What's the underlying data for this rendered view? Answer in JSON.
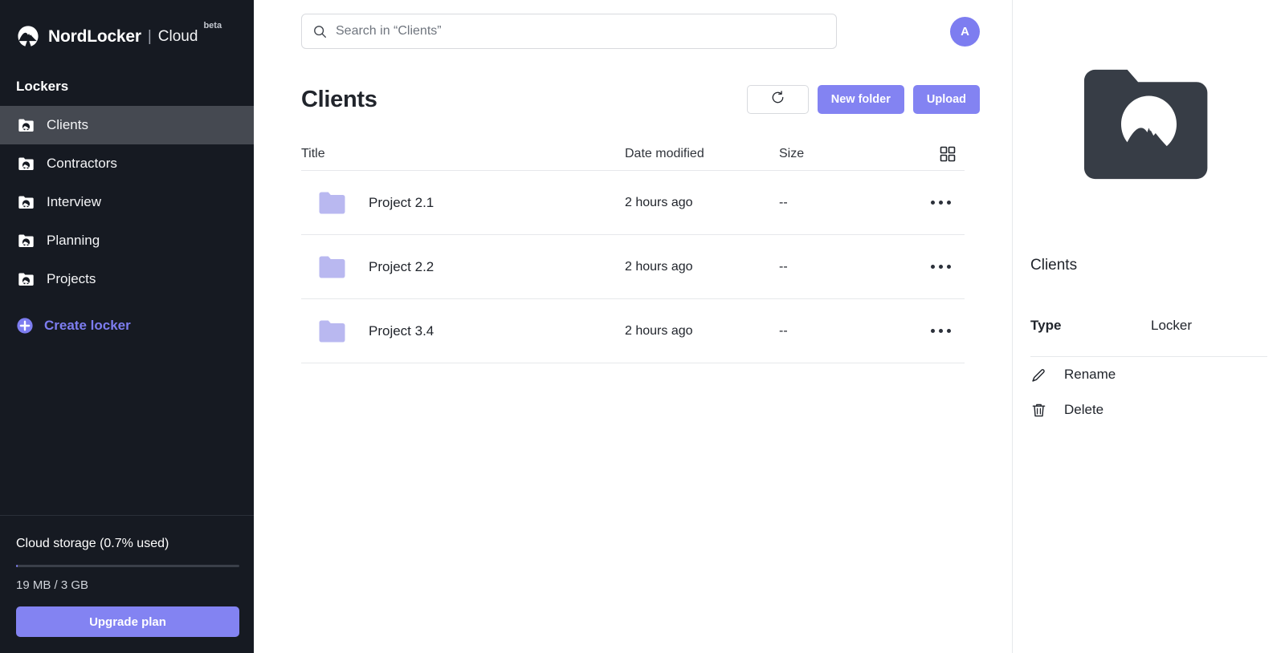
{
  "brand": {
    "name": "NordLocker",
    "separator": "|",
    "product": "Cloud",
    "badge": "beta",
    "logo_icon": "nordlocker-mountain-icon"
  },
  "sidebar": {
    "section_title": "Lockers",
    "items": [
      {
        "label": "Clients",
        "icon": "locker-folder-icon",
        "active": true
      },
      {
        "label": "Contractors",
        "icon": "locker-folder-icon",
        "active": false
      },
      {
        "label": "Interview",
        "icon": "locker-folder-icon",
        "active": false
      },
      {
        "label": "Planning",
        "icon": "locker-folder-icon",
        "active": false
      },
      {
        "label": "Projects",
        "icon": "locker-folder-icon",
        "active": false
      }
    ],
    "create_locker": {
      "label": "Create locker",
      "icon": "plus-circle-icon"
    },
    "storage": {
      "title": "Cloud storage (0.7% used)",
      "percent_used": 0.7,
      "detail": "19 MB / 3 GB",
      "upgrade_label": "Upgrade plan"
    },
    "colors": {
      "background": "#161a22",
      "active_item": "#454951",
      "accent": "#7d7df0"
    }
  },
  "topbar": {
    "search": {
      "placeholder": "Search in “Clients”",
      "value": "",
      "icon": "search-icon"
    },
    "avatar": {
      "initial": "A",
      "color": "#7d7df0"
    }
  },
  "page": {
    "title": "Clients",
    "actions": {
      "refresh": {
        "label": "",
        "icon": "refresh-icon"
      },
      "new_folder": "New folder",
      "upload": "Upload"
    },
    "view_toggle_icon": "grid-view-icon"
  },
  "table": {
    "columns": [
      "Title",
      "Date modified",
      "Size"
    ],
    "rows": [
      {
        "icon": "folder-icon",
        "title": "Project 2.1",
        "date_modified": "2 hours ago",
        "size": "--",
        "menu_icon": "more-options-icon"
      },
      {
        "icon": "folder-icon",
        "title": "Project 2.2",
        "date_modified": "2 hours ago",
        "size": "--",
        "menu_icon": "more-options-icon"
      },
      {
        "icon": "folder-icon",
        "title": "Project 3.4",
        "date_modified": "2 hours ago",
        "size": "--",
        "menu_icon": "more-options-icon"
      }
    ]
  },
  "details": {
    "hero_icon": "locker-folder-large-icon",
    "name": "Clients",
    "type_key": "Type",
    "type_value": "Locker",
    "actions": [
      {
        "label": "Rename",
        "icon": "pencil-icon"
      },
      {
        "label": "Delete",
        "icon": "trash-icon"
      }
    ]
  },
  "colors": {
    "accent_purple": "#8383f2",
    "folder_purple": "#b9b8f0",
    "dark_panel": "#161a22",
    "text_dark": "#21252c"
  }
}
